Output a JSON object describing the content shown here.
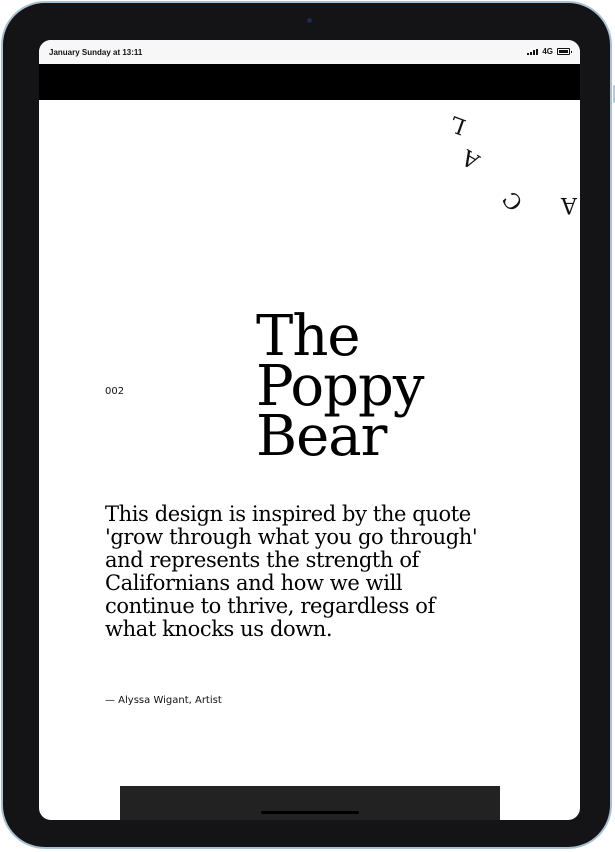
{
  "status_bar": {
    "time_text": "January Sunday at 13:11",
    "network": "4G",
    "icons": [
      "signal-icon",
      "battery-icon"
    ]
  },
  "circular_text": {
    "letters": [
      "L",
      "A",
      "C",
      "A"
    ]
  },
  "page": {
    "number": "002",
    "title_lines": [
      "The",
      "Poppy",
      "Bear"
    ],
    "quote": "This design is inspired by the quote 'grow through what you go through' and represents the strength of Californians and how we will continue to thrive, regardless of what knocks us down.",
    "attribution": "— Alyssa Wigant, Artist"
  },
  "colors": {
    "device_frame": "#141416",
    "device_edge": "#a9c0d2",
    "banner": "#000000",
    "bottom_panel": "#222222",
    "text": "#000000"
  }
}
